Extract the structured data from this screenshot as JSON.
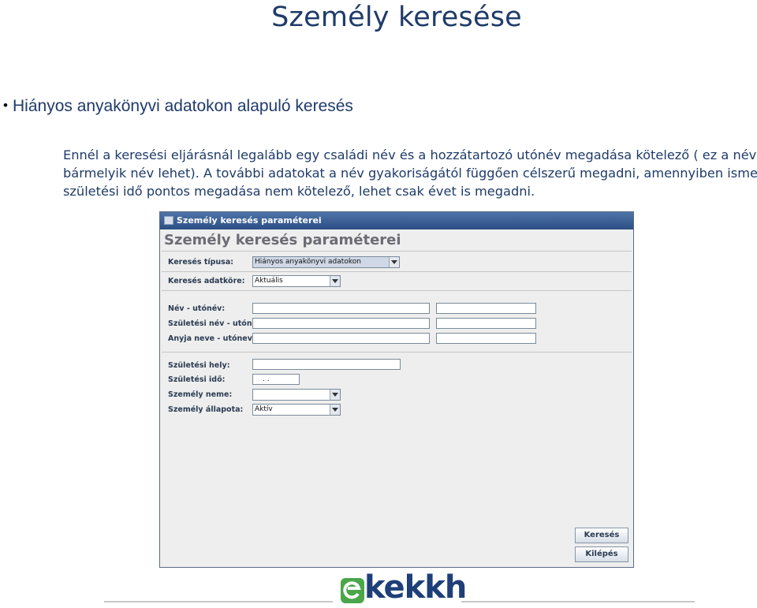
{
  "slide": {
    "title": "Személy keresése",
    "bullet": "Hiányos anyakönyvi adatokon alapuló keresés",
    "paragraph_lines": [
      "Ennél a keresési eljárásnál legalább egy családi név és a hozzátartozó utónév megadása kötelező ( ez a névadat",
      "bármelyik név lehet). A további adatokat a név gyakoriságától függően célszerű megadni, amennyiben ismert.  A",
      "születési idő pontos megadása nem kötelező, lehet csak évet is megadni."
    ]
  },
  "window": {
    "title": "Személy keresés paraméterei",
    "header": "Személy keresés paraméterei",
    "labels": {
      "search_type": "Keresés típusa:",
      "search_scope": "Keresés adatköre:",
      "name": "Név - utónév:",
      "birth_name": "Születési név - utónév:",
      "mother_name": "Anyja neve - utóneve:",
      "birth_place": "Születési hely:",
      "birth_date": "Születési idő:",
      "gender": "Személy neme:",
      "status": "Személy állapota:"
    },
    "values": {
      "search_type": "Hiányos anyakönyvi adatokon",
      "search_scope": "Aktuális",
      "birth_date": ". .",
      "gender": "",
      "status": "Aktív"
    },
    "buttons": {
      "search": "Keresés",
      "exit": "Kilépés"
    }
  },
  "footer": {
    "logo_text": "kekkh",
    "accent_color": "#4aa64a",
    "brand_color": "#1e3f78"
  }
}
